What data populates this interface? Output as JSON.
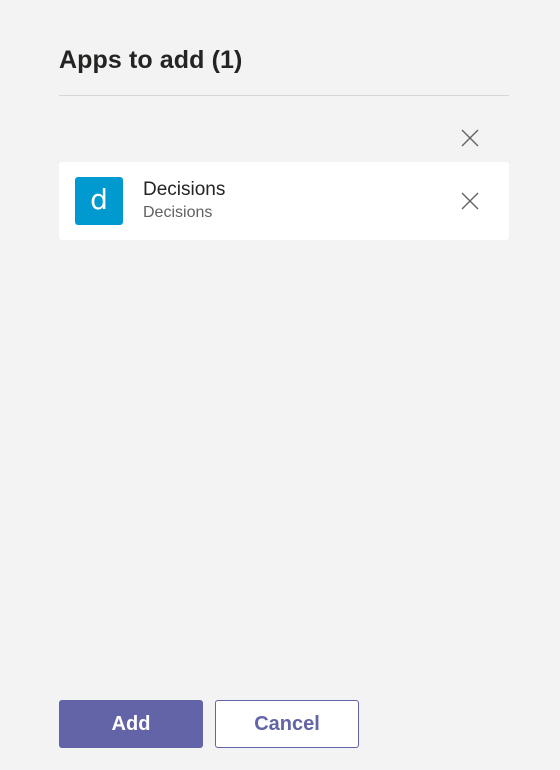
{
  "panel": {
    "title": "Apps to add (1)"
  },
  "icons": {
    "clear_all": "close-icon",
    "remove_app": "close-icon"
  },
  "apps": [
    {
      "icon_letter": "d",
      "icon_color": "#0099d0",
      "name": "Decisions",
      "subtitle": "Decisions"
    }
  ],
  "buttons": {
    "add_label": "Add",
    "cancel_label": "Cancel"
  },
  "colors": {
    "accent": "#6264a7",
    "background": "#f3f3f3"
  }
}
